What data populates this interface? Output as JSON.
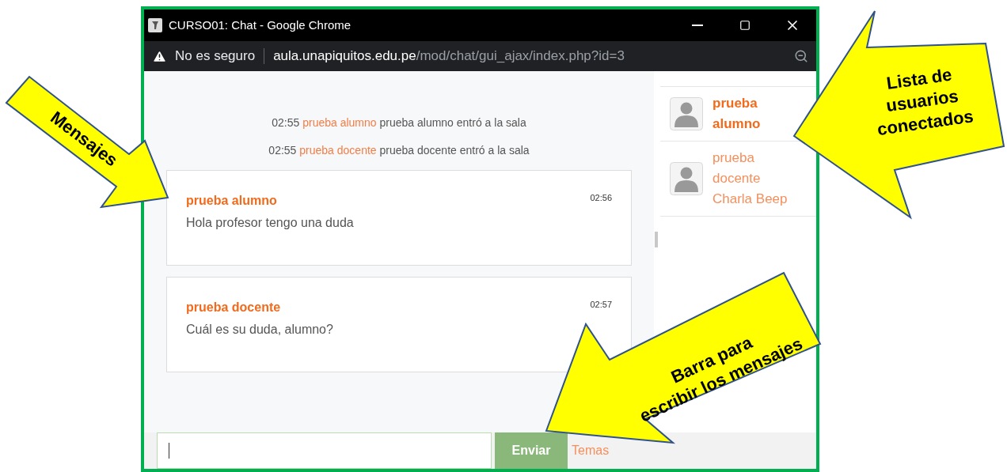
{
  "window": {
    "title": "CURSO01: Chat - Google Chrome"
  },
  "address_bar": {
    "security": "No es seguro",
    "host": "aula.unapiquitos.edu.pe",
    "path": "/mod/chat/gui_ajax/index.php?id=3"
  },
  "system_messages": [
    {
      "time": "02:55",
      "user": "prueba alumno",
      "text": "prueba alumno entró a la sala"
    },
    {
      "time": "02:55",
      "user": "prueba docente",
      "text": "prueba docente entró a la sala"
    }
  ],
  "messages": [
    {
      "author": "prueba alumno",
      "time": "02:56",
      "text": "Hola profesor tengo una duda"
    },
    {
      "author": "prueba docente",
      "time": "02:57",
      "text": "Cuál es su duda, alumno?"
    }
  ],
  "users": [
    {
      "name": "prueba alumno",
      "selected": true
    },
    {
      "name": "prueba docente",
      "selected": false,
      "action": "Charla Beep"
    }
  ],
  "composer": {
    "send": "Enviar",
    "link": "Temas"
  },
  "annotations": [
    {
      "lines": [
        "Mensajes"
      ]
    },
    {
      "lines": [
        "Lista de",
        "usuarios",
        "conectados"
      ]
    },
    {
      "lines": [
        "Barra para",
        "escribir los mensajes"
      ]
    }
  ]
}
